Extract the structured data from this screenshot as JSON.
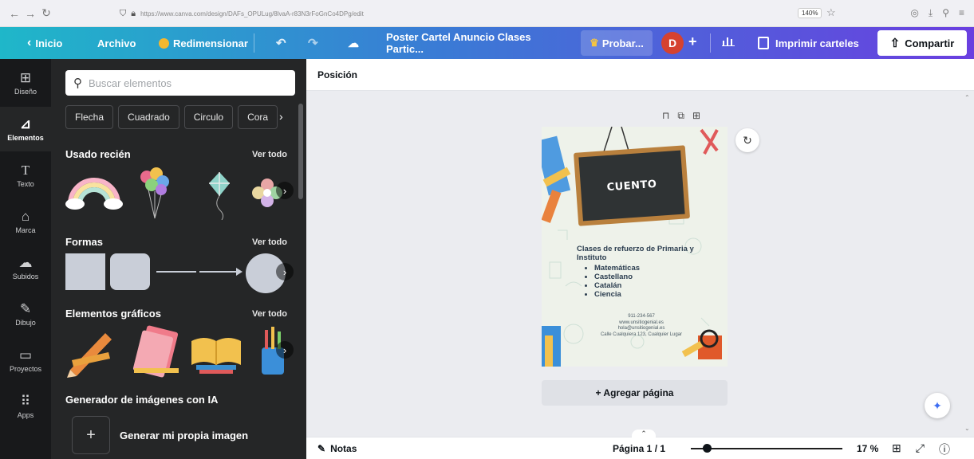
{
  "browser": {
    "url": "https://www.canva.com/design/DAFs_OPULug/8lvaA-r83N3rFoGnCo4DPg/edit",
    "zoom": "140%"
  },
  "header": {
    "home": "Inicio",
    "file": "Archivo",
    "resize": "Redimensionar",
    "doc_title": "Poster Cartel Anuncio Clases Partic...",
    "try_pro": "Probar...",
    "avatar_initial": "D",
    "print": "Imprimir carteles",
    "share": "Compartir"
  },
  "rail": [
    {
      "label": "Diseño",
      "icon": "layout-icon"
    },
    {
      "label": "Elementos",
      "icon": "shapes-icon"
    },
    {
      "label": "Texto",
      "icon": "text-icon"
    },
    {
      "label": "Marca",
      "icon": "brand-icon"
    },
    {
      "label": "Subidos",
      "icon": "upload-icon"
    },
    {
      "label": "Dibujo",
      "icon": "draw-icon"
    },
    {
      "label": "Proyectos",
      "icon": "folder-icon"
    },
    {
      "label": "Apps",
      "icon": "apps-icon"
    }
  ],
  "panel": {
    "search_placeholder": "Buscar elementos",
    "chips": [
      "Flecha",
      "Cuadrado",
      "Circulo",
      "Cora"
    ],
    "recent_title": "Usado recién",
    "shapes_title": "Formas",
    "graphics_title": "Elementos gráficos",
    "see_all": "Ver todo",
    "ai_title": "Generador de imágenes con IA",
    "ai_action": "Generar mi propia imagen"
  },
  "editor": {
    "position": "Posición",
    "add_page": "+ Agregar página",
    "notes": "Notas",
    "page_indicator": "Página 1 / 1",
    "zoom": "17 %",
    "zoom_level": 0.17
  },
  "poster": {
    "board_text": "CUENTO",
    "heading": "Clases de refuerzo de Primaria y Instituto",
    "subjects": [
      "Matemáticas",
      "Castellano",
      "Catalán",
      "Ciencia"
    ],
    "phone": "911-234-567",
    "web": "www.unsitiogenial.es",
    "email": "hola@unsitiogenial.es",
    "address": "Calle Cualquiera 123, Cualquier Lugar"
  }
}
